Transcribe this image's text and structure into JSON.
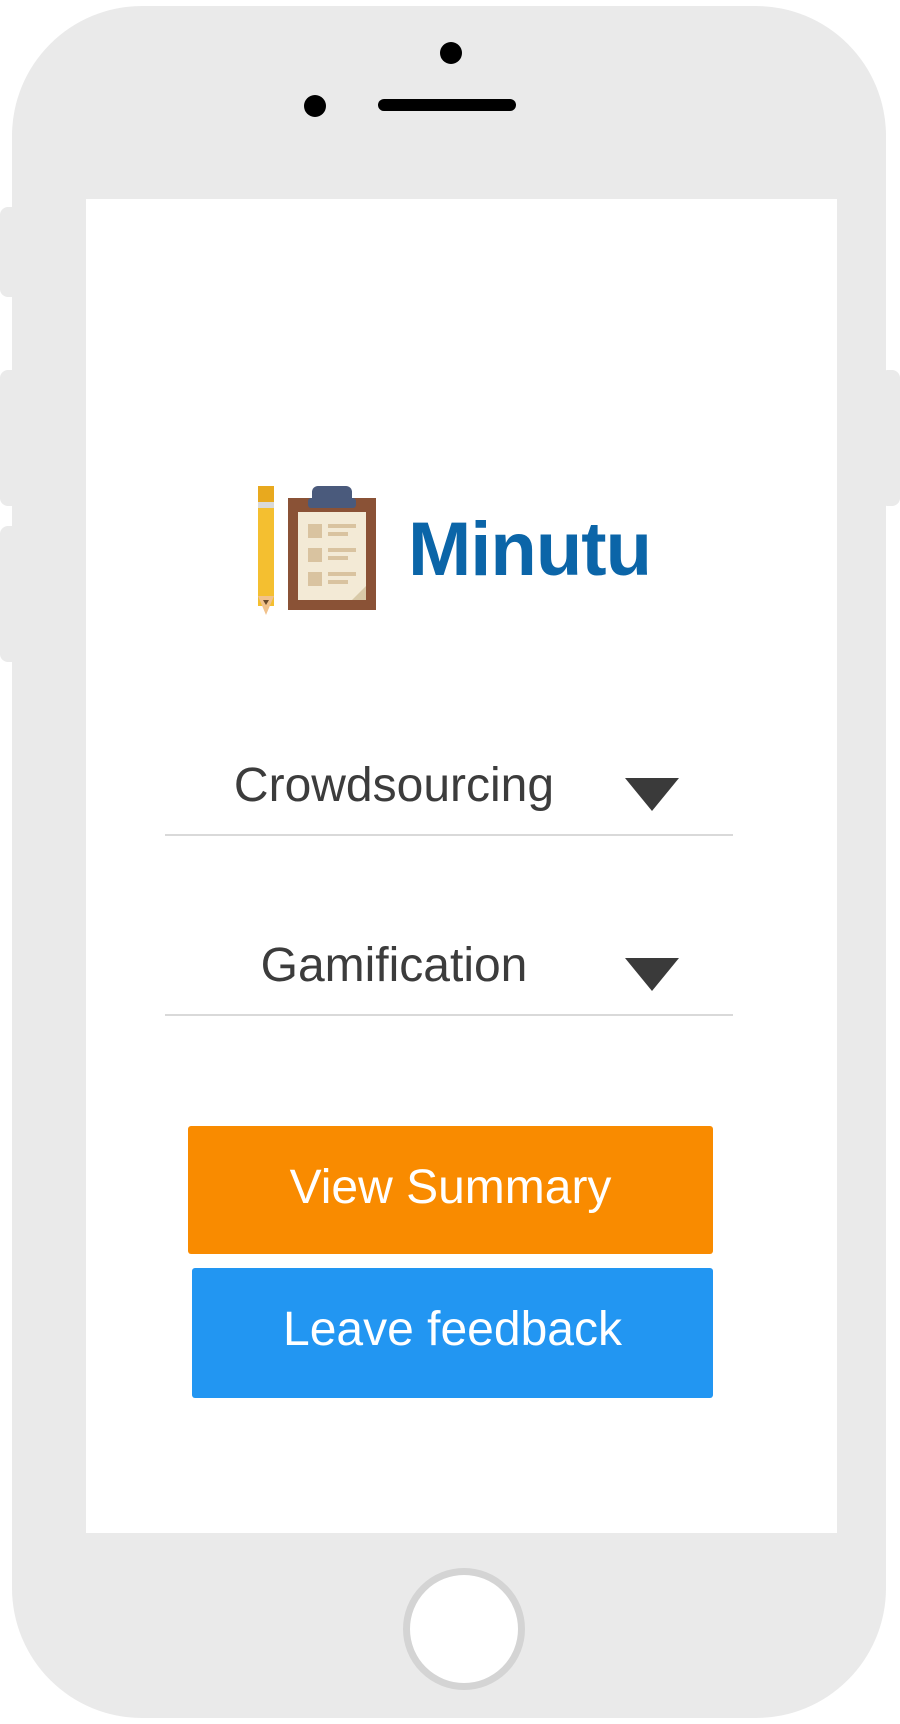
{
  "app": {
    "name": "Minutu",
    "brand_color": "#0b65a8"
  },
  "filters": {
    "category": {
      "selected": "Crowdsourcing"
    },
    "topic": {
      "selected": "Gamification"
    }
  },
  "actions": {
    "view_summary_label": "View Summary",
    "view_summary_color": "#f98b00",
    "feedback_label": "Leave feedback",
    "feedback_color": "#2296f2"
  },
  "icons": {
    "logo": "clipboard-with-pencil-icon",
    "dropdown": "caret-down-icon",
    "home": "home-button-icon"
  }
}
